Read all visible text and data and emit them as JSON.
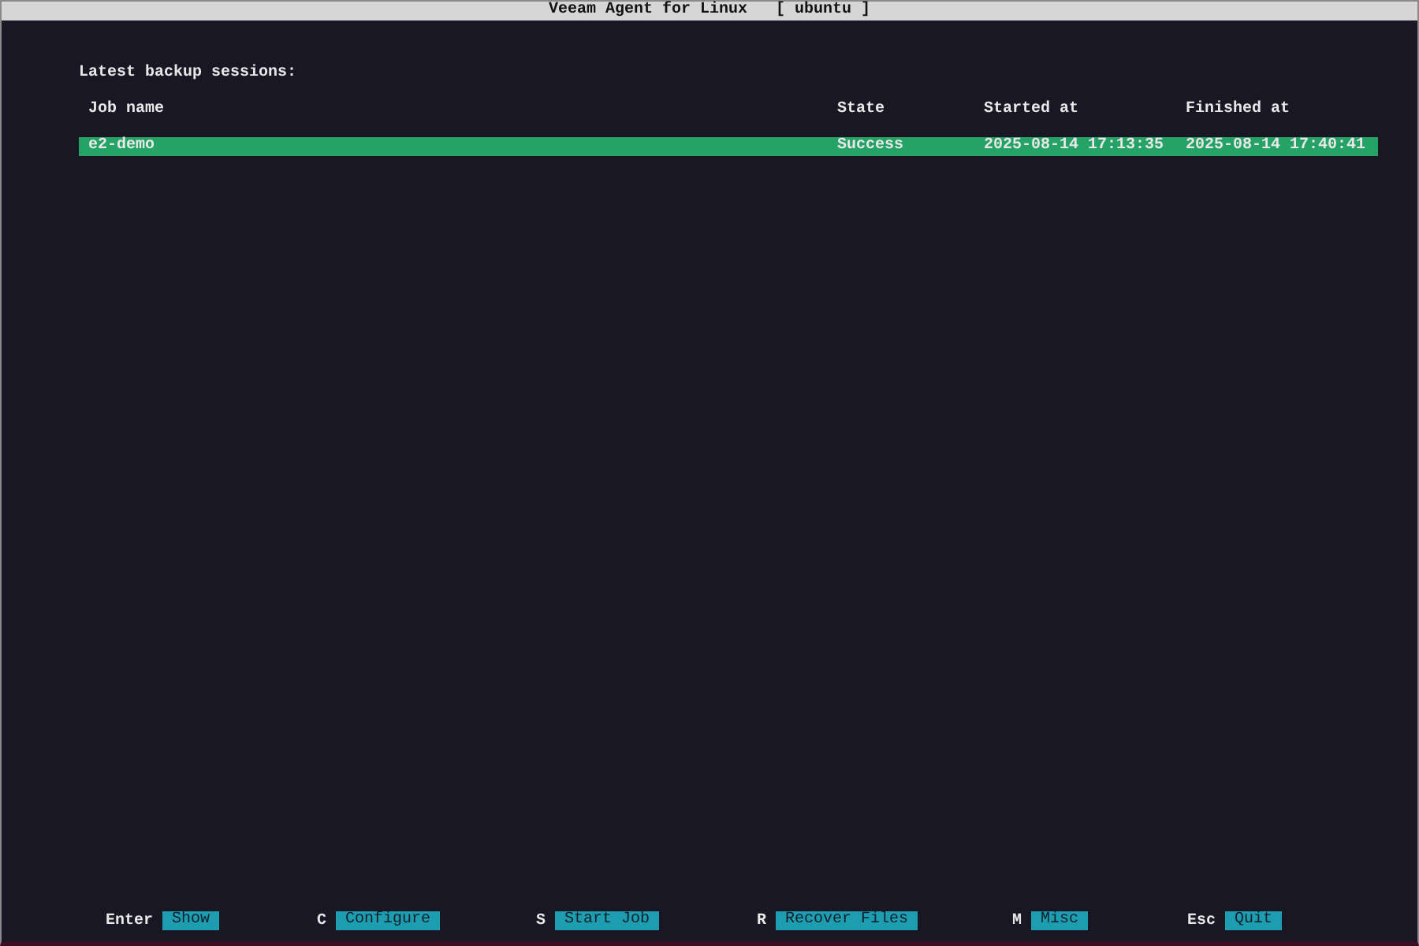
{
  "window": {
    "title": "Veeam Agent for Linux",
    "host": "[ ubuntu ]"
  },
  "heading": "Latest backup sessions:",
  "table": {
    "columns": [
      "Job name",
      "State",
      "Started at",
      "Finished at"
    ],
    "rows": [
      {
        "cells": [
          "e2-demo",
          "Success",
          "2025-08-14 17:13:35",
          "2025-08-14 17:40:41"
        ],
        "selected": true
      }
    ]
  },
  "shortcuts": [
    {
      "key": "Enter",
      "action": "Show"
    },
    {
      "key": "C",
      "action": "Configure"
    },
    {
      "key": "S",
      "action": "Start Job"
    },
    {
      "key": "R",
      "action": "Recover Files"
    },
    {
      "key": "M",
      "action": "Misc"
    },
    {
      "key": "Esc",
      "action": "Quit"
    }
  ]
}
